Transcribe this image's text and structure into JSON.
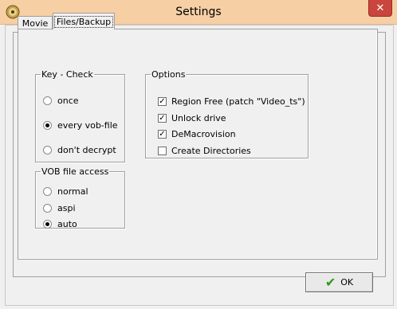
{
  "window": {
    "title": "Settings",
    "close_label": "✕"
  },
  "tabs": [
    {
      "label": "Movie"
    },
    {
      "label": "Files/Backup",
      "selected": true
    }
  ],
  "key_check": {
    "legend": "Key - Check",
    "options": [
      {
        "label": "once",
        "selected": false
      },
      {
        "label": "every vob-file",
        "selected": true
      },
      {
        "label": "don't decrypt",
        "selected": false
      }
    ]
  },
  "vob_access": {
    "legend": "VOB file access",
    "options": [
      {
        "label": "normal",
        "selected": false
      },
      {
        "label": "aspi",
        "selected": false
      },
      {
        "label": "auto",
        "selected": true
      }
    ]
  },
  "options": {
    "legend": "Options",
    "items": [
      {
        "label": "Region Free  (patch \"Video_ts\")",
        "checked": true
      },
      {
        "label": "Unlock drive",
        "checked": true
      },
      {
        "label": "DeMacrovision",
        "checked": true
      },
      {
        "label": "Create Directories",
        "checked": false
      }
    ]
  },
  "ok_button": {
    "label": "OK",
    "icon": "checkmark-icon"
  },
  "colors": {
    "titlebar": "#f6cfa4",
    "close": "#c9463d",
    "ok_check": "#2f9a1c"
  }
}
